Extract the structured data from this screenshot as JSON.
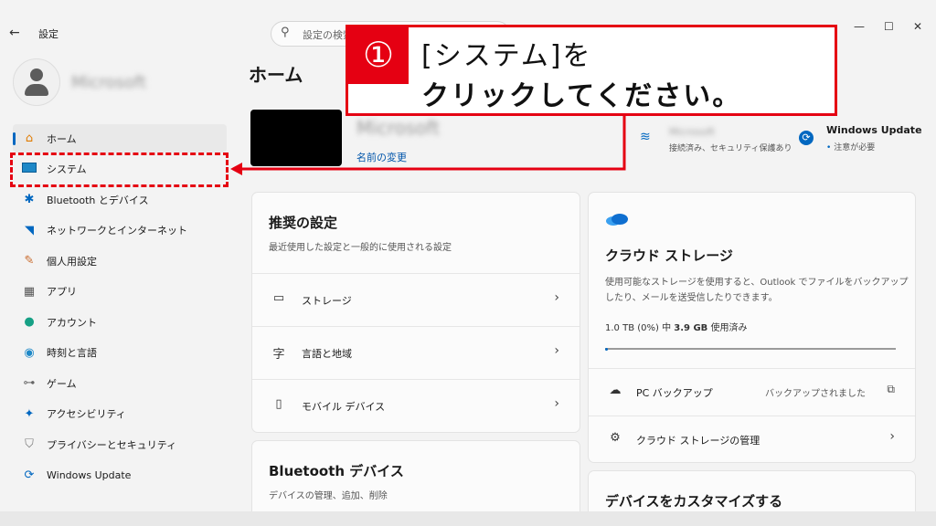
{
  "window": {
    "title": "設定",
    "back_icon": "back-arrow-icon",
    "search_placeholder": "設定の検索",
    "controls": [
      "minimize",
      "maximize",
      "close"
    ]
  },
  "profile": {
    "name": "Microsoft"
  },
  "sidebar": {
    "items": [
      {
        "label": "ホーム",
        "icon": "home-icon",
        "active": true
      },
      {
        "label": "システム",
        "icon": "system-icon"
      },
      {
        "label": "Bluetooth とデバイス",
        "icon": "bluetooth-icon"
      },
      {
        "label": "ネットワークとインターネット",
        "icon": "wifi-icon"
      },
      {
        "label": "個人用設定",
        "icon": "brush-icon"
      },
      {
        "label": "アプリ",
        "icon": "apps-icon"
      },
      {
        "label": "アカウント",
        "icon": "account-icon"
      },
      {
        "label": "時刻と言語",
        "icon": "globe-clock-icon"
      },
      {
        "label": "ゲーム",
        "icon": "gamepad-icon"
      },
      {
        "label": "アクセシビリティ",
        "icon": "accessibility-icon"
      },
      {
        "label": "プライバシーとセキュリティ",
        "icon": "shield-icon"
      },
      {
        "label": "Windows Update",
        "icon": "sync-icon"
      }
    ]
  },
  "main": {
    "title": "ホーム",
    "device": {
      "name": "Microsoft",
      "rename_link": "名前の変更"
    },
    "network": {
      "name": "Microsoft",
      "status": "接続済み、セキュリティ保護あり"
    },
    "update": {
      "title": "Windows Update",
      "status": "注意が必要"
    },
    "recommended": {
      "title": "推奨の設定",
      "description": "最近使用した設定と一般的に使用される設定",
      "rows": [
        {
          "label": "ストレージ",
          "icon": "storage-icon"
        },
        {
          "label": "言語と地域",
          "icon": "language-icon"
        },
        {
          "label": "モバイル デバイス",
          "icon": "phone-icon"
        }
      ]
    },
    "bluetooth_card": {
      "title": "Bluetooth デバイス",
      "description": "デバイスの管理、追加、削除"
    },
    "cloud": {
      "title": "クラウド ストレージ",
      "description_line1": "使用可能なストレージを使用すると、Outlook でファイルをバックアップ",
      "description_line2": "したり、メールを送受信したりできます。",
      "usage_prefix": "1.0 TB (0%) 中 ",
      "usage_bold": "3.9 GB",
      "usage_suffix": " 使用済み",
      "usage_fraction": 0.004,
      "backup_label": "PC バックアップ",
      "backup_status": "バックアップされました",
      "manage_label": "クラウド ストレージの管理"
    },
    "customize": {
      "title": "デバイスをカスタマイズする"
    }
  },
  "annotation": {
    "number": "①",
    "line1": "[システム]を",
    "line2": "クリックしてください。"
  },
  "colors": {
    "accent": "#0067c0",
    "annotation": "#e50012"
  }
}
